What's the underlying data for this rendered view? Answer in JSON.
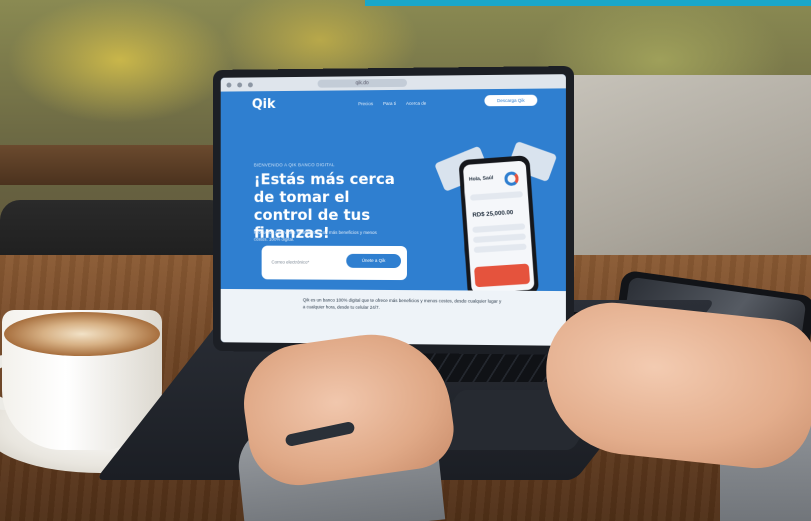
{
  "laptop_screen": {
    "browser": {
      "url": "qik.do"
    },
    "nav": {
      "logo": "Qik",
      "links": [
        "Precios",
        "Para ti",
        "Acerca de"
      ],
      "cta": "Descarga Qik"
    },
    "hero": {
      "eyebrow": "BIENVENIDO A QIK BANCO DIGITAL",
      "headline": "¡Estás más cerca de tomar el control de tus finanzas!",
      "subtext": "Productos y servicios financieros, con más beneficios y menos costos. 100% digital.",
      "email_placeholder": "Correo electrónico*",
      "email_button": "Únete a Qik"
    },
    "phone_mockup": {
      "title": "Hola, Saúl",
      "amount": "RD$ 25,000.00"
    },
    "footer_text": "Qik es un banco 100% digital que te ofrece más beneficios y menos costos, desde cualquier lugar y a cualquier hora, desde tu celular 24/7."
  },
  "colors": {
    "brand_blue": "#2f7fd0",
    "accent_red": "#e5533d",
    "top_band": "#1aa7c9"
  }
}
